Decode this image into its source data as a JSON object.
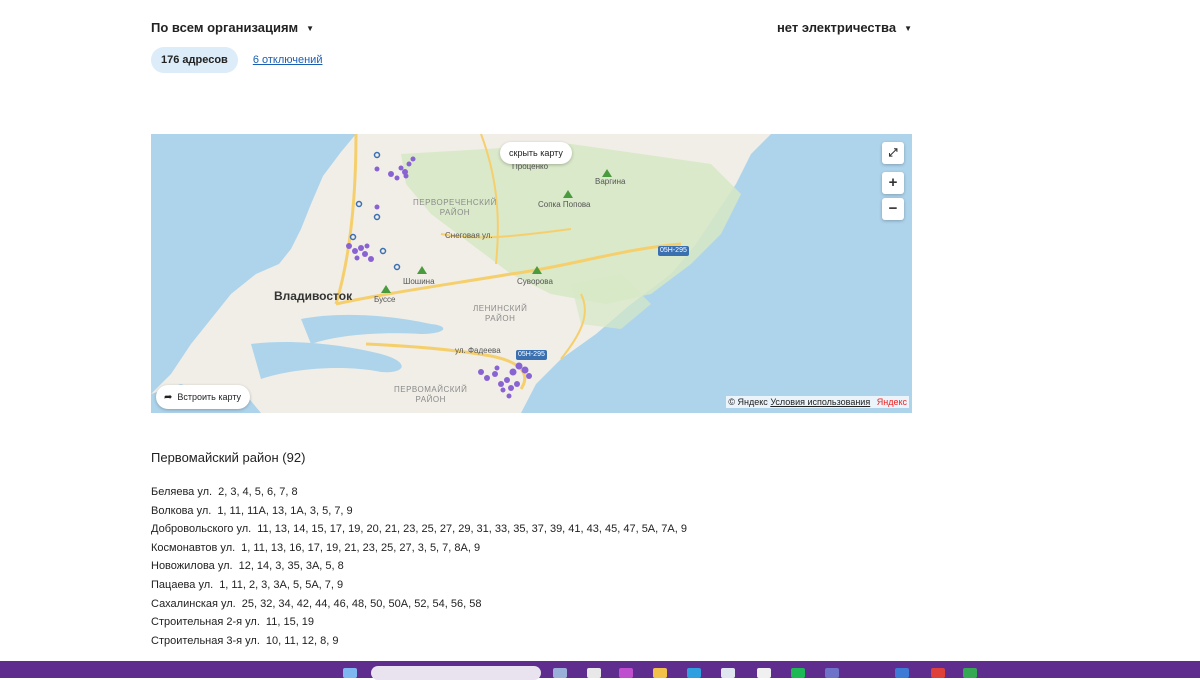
{
  "filters": {
    "organization": "По всем организациям",
    "type": "нет электричества"
  },
  "tabs": {
    "addresses": "176 адресов",
    "outages": "6 отключений"
  },
  "map": {
    "hide_button": "скрыть карту",
    "embed_button": "Встроить карту",
    "zoom_in": "+",
    "zoom_out": "−",
    "fullscreen": "⤢",
    "attribution_copy": "© Яндекс",
    "attribution_terms": "Условия использования",
    "attribution_brand": "Яндекс",
    "city": "Владивосток",
    "places": {
      "procenko": "Проценко",
      "vargina": "Варгина",
      "sopka_popova": "Сопка Попова",
      "snegovaya": "Снеговая ул.",
      "shoshina": "Шошина",
      "busse": "Буссе",
      "suvorova": "Суворова",
      "fadeeva": "ул. Фадеева"
    },
    "districts": {
      "pervorechensky_1": "Первореченский",
      "pervorechensky_2": "район",
      "leninsky_1": "Ленинский",
      "leninsky_2": "район",
      "pervomaisky_1": "Первомайский",
      "pervomaisky_2": "район"
    },
    "road_badges": {
      "r1": "05Н-295",
      "r2": "05Н-295"
    },
    "colors": {
      "water": "#aed4ec",
      "land": "#f1eee7",
      "park": "#d6e8c4",
      "road": "#f6cf6d",
      "marker": "#8a63d2"
    }
  },
  "district": {
    "title": "Первомайский район (92)",
    "streets": [
      {
        "name": "Беляева ул.",
        "numbers": "2, 3, 4, 5, 6, 7, 8"
      },
      {
        "name": "Волкова ул.",
        "numbers": "1, 11, 11А, 13, 1А, 3, 5, 7, 9"
      },
      {
        "name": "Добровольского ул.",
        "numbers": "11, 13, 14, 15, 17, 19, 20, 21, 23, 25, 27, 29, 31, 33, 35, 37, 39, 41, 43, 45, 47, 5А, 7А, 9"
      },
      {
        "name": "Космонавтов ул.",
        "numbers": "1, 11, 13, 16, 17, 19, 21, 23, 25, 27, 3, 5, 7, 8А, 9"
      },
      {
        "name": "Новожилова ул.",
        "numbers": "12, 14, 3, 35, 3А, 5, 8"
      },
      {
        "name": "Пацаева ул.",
        "numbers": "1, 11, 2, 3, 3А, 5, 5А, 7, 9"
      },
      {
        "name": "Сахалинская ул.",
        "numbers": "25, 32, 34, 42, 44, 46, 48, 50, 50А, 52, 54, 56, 58"
      },
      {
        "name": "Строительная 2-я ул.",
        "numbers": "11, 15, 19"
      },
      {
        "name": "Строительная 3-я ул.",
        "numbers": "10, 11, 12, 8, 9"
      }
    ]
  }
}
